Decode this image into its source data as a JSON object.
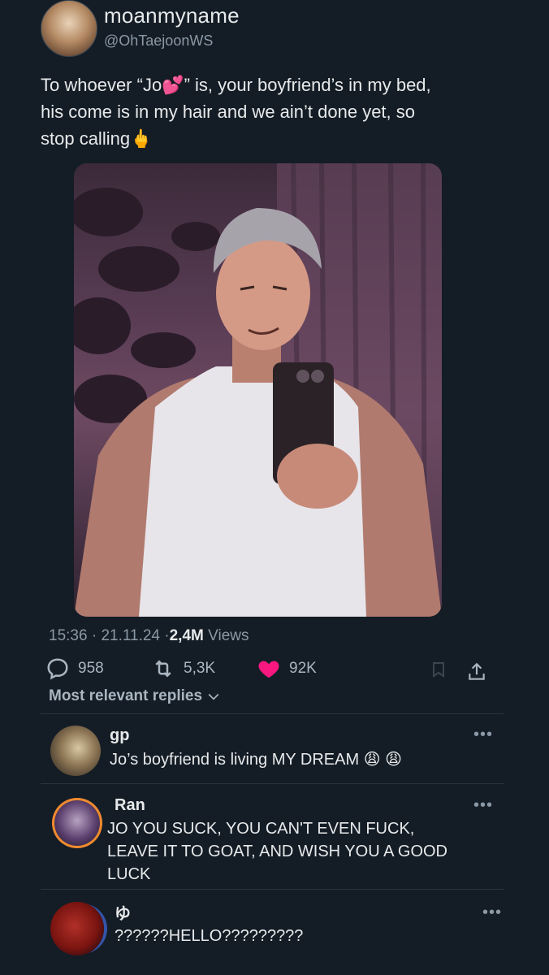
{
  "tweet": {
    "display_name": "moanmyname",
    "handle": "@OhTaejoonWS",
    "text_before": "To whoever “Jo",
    "text_emoji": "💕",
    "text_after": "” is, your boyfriend’s in my bed,\nhis come is in my hair and we ain’t done yet, so\nstop calling",
    "text_end_emoji": "🖕",
    "time": "15:36",
    "date": "21.11.24",
    "views_count": "2,4M",
    "views_label": "Views"
  },
  "actions": {
    "replies": "958",
    "reposts": "5,3K",
    "likes": "92K"
  },
  "replies_header": "Most relevant replies",
  "replies": [
    {
      "name": "gp",
      "text": "Jo’s boyfriend is living MY DREAM 😩 😩"
    },
    {
      "name": "Ran",
      "text": "JO YOU SUCK, YOU CAN'T EVEN FUCK,\nLEAVE IT TO GOAT, AND WISH YOU A GOOD\nLUCK"
    },
    {
      "name": "ゆ",
      "text": "??????HELLO?????????"
    }
  ],
  "colors": {
    "background": "#141d26",
    "like": "#f91880",
    "muted": "#8b98a5"
  }
}
